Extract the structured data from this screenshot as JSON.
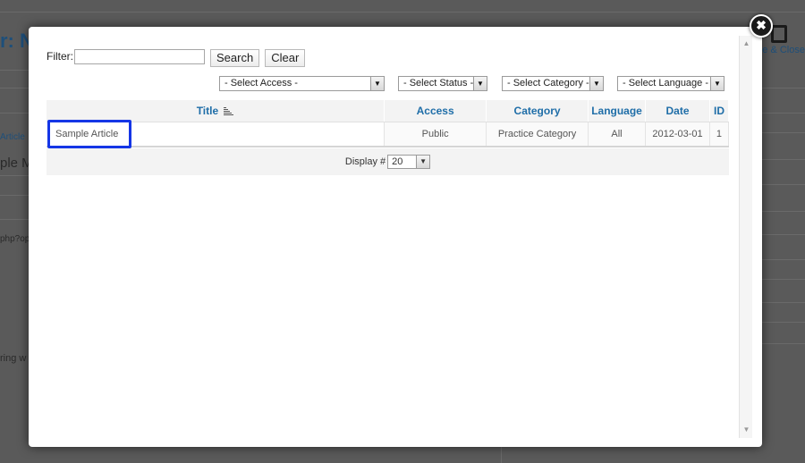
{
  "background": {
    "title_fragment": "r: N",
    "article_fragment": "ple M",
    "link_fragment": "Article",
    "php_fragment": "php?op",
    "text_fragment": "ring w",
    "save_close_fragment": "e & Close"
  },
  "modal": {
    "close_symbol": "✖",
    "filter": {
      "label": "Filter:",
      "value": "",
      "search_label": "Search",
      "clear_label": "Clear"
    },
    "selects": {
      "access": "- Select Access -",
      "status": "- Select Status -",
      "category": "- Select Category -",
      "language": "- Select Language -"
    },
    "table": {
      "headers": {
        "title": "Title",
        "access": "Access",
        "category": "Category",
        "language": "Language",
        "date": "Date",
        "id": "ID"
      },
      "rows": [
        {
          "title": "Sample Article",
          "access": "Public",
          "category": "Practice Category",
          "language": "All",
          "date": "2012-03-01",
          "id": "1"
        }
      ]
    },
    "pagination": {
      "display_label": "Display #",
      "display_value": "20"
    }
  },
  "colors": {
    "header_text": "#1f6ea8",
    "highlight": "#1536e6"
  },
  "icons": {
    "close": "close-icon",
    "sort": "sort-ascending-icon",
    "dropdown": "chevron-down-icon",
    "save": "save-icon"
  }
}
